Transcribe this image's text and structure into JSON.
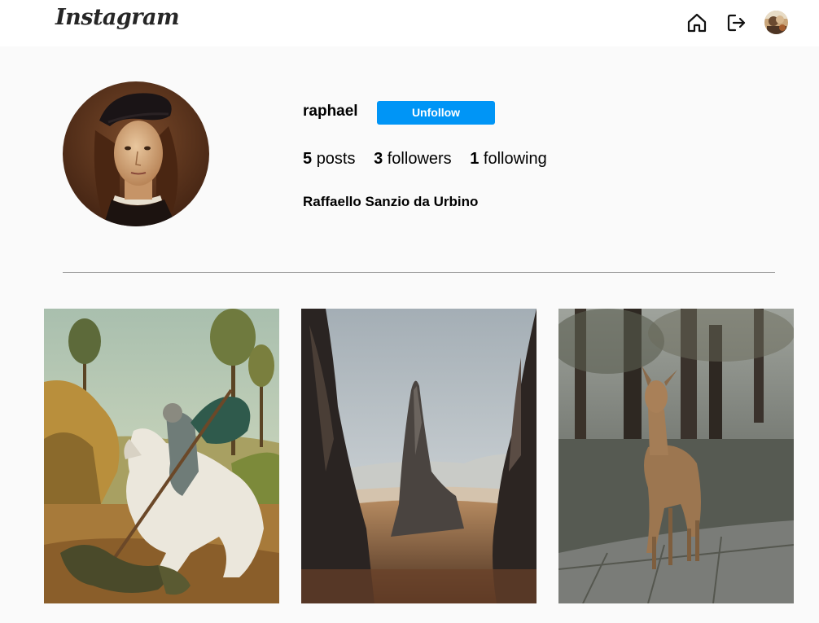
{
  "header": {
    "logo_text": "Instagram",
    "icons": [
      "home-icon",
      "logout-icon",
      "avatar"
    ]
  },
  "profile": {
    "username": "raphael",
    "follow_button_label": "Unfollow",
    "stats": {
      "posts_count": "5",
      "posts_label": "posts",
      "followers_count": "3",
      "followers_label": "followers",
      "following_count": "1",
      "following_label": "following"
    },
    "full_name": "Raffaello Sanzio da Urbino"
  },
  "posts": [
    {
      "subject": "painting-st-george-and-dragon"
    },
    {
      "subject": "mountain-rock-spire-landscape"
    },
    {
      "subject": "deer-in-forest"
    }
  ],
  "colors": {
    "accent": "#0095f6",
    "background": "#fafafa",
    "header_background": "#ffffff"
  }
}
